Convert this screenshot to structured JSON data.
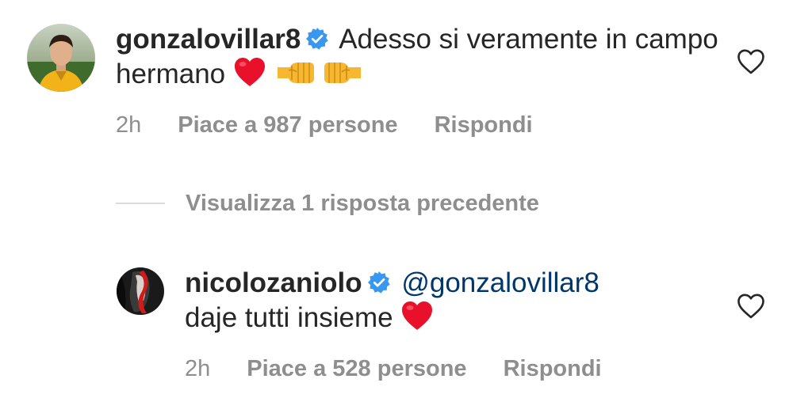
{
  "comments": [
    {
      "username": "gonzalovillar8",
      "verified": true,
      "text": "Adesso si veramente in campo hermano",
      "emojis": [
        "red-heart",
        "fist-left",
        "fist-right"
      ],
      "time": "2h",
      "likes": "Piace a 987 persone",
      "reply_label": "Rispondi"
    },
    {
      "username": "nicolozaniolo",
      "verified": true,
      "mention": "@gonzalovillar8",
      "text": "daje tutti insieme",
      "emojis": [
        "red-heart"
      ],
      "time": "2h",
      "likes": "Piace a 528 persone",
      "reply_label": "Rispondi"
    }
  ],
  "view_replies": {
    "label": "Visualizza 1 risposta precedente"
  },
  "colors": {
    "text": "#262626",
    "secondary": "#8e8e8e",
    "mention": "#00376b",
    "verified": "#3897f0",
    "heart": "#ed4956"
  }
}
